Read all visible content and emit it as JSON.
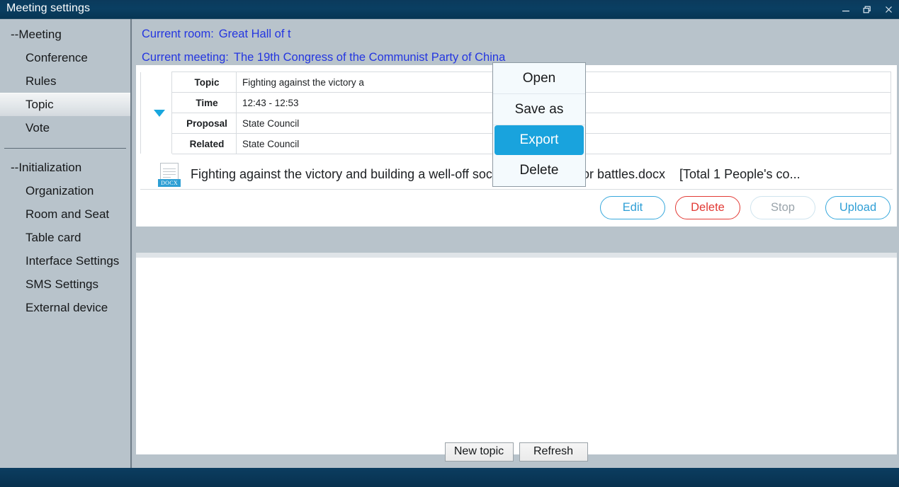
{
  "window": {
    "title": "Meeting settings",
    "controls": [
      {
        "name": "minimize",
        "glyph": "minimize-icon"
      },
      {
        "name": "restore",
        "glyph": "restore-icon"
      },
      {
        "name": "close",
        "glyph": "close-icon"
      }
    ]
  },
  "sidebar": {
    "groups": [
      {
        "head": "--Meeting",
        "items": [
          {
            "label": "Conference",
            "selected": false
          },
          {
            "label": "Rules",
            "selected": false
          },
          {
            "label": "Topic",
            "selected": true
          },
          {
            "label": "Vote",
            "selected": false
          }
        ]
      },
      {
        "head": "--Initialization",
        "items": [
          {
            "label": "Organization",
            "selected": false
          },
          {
            "label": "Room and Seat",
            "selected": false
          },
          {
            "label": "Table card",
            "selected": false
          },
          {
            "label": "Interface Settings",
            "selected": false
          },
          {
            "label": "SMS Settings",
            "selected": false
          },
          {
            "label": "External device",
            "selected": false
          }
        ]
      }
    ]
  },
  "header": {
    "room_label": "Current room:",
    "room_value": "Great Hall of t",
    "meeting_label": "Current meeting:",
    "meeting_value": "The 19th Congress of the Communist Party of China",
    "text_color": "#2436e0"
  },
  "topic_table": {
    "expand_icon": "chevron-down-icon",
    "rows": [
      {
        "label": "Topic",
        "value": "Fighting against the victory a"
      },
      {
        "label": "Time",
        "value": "12:43 - 12:53"
      },
      {
        "label": "Proposal",
        "value": "State Council"
      },
      {
        "label": "Related",
        "value": "State Council"
      }
    ]
  },
  "attachment": {
    "icon": "docx-file-icon",
    "icon_badge": "DOCX",
    "file_name": "Fighting against the victory and building a well-off society in three major battles.docx",
    "meta": "[Total 1 People's co..."
  },
  "actions": [
    {
      "label": "Edit",
      "style": "blue",
      "enabled": true
    },
    {
      "label": "Delete",
      "style": "red",
      "enabled": true
    },
    {
      "label": "Stop",
      "style": "muted",
      "enabled": false
    },
    {
      "label": "Upload",
      "style": "blue",
      "enabled": true
    }
  ],
  "footer": {
    "buttons": [
      {
        "label": "New topic"
      },
      {
        "label": "Refresh"
      }
    ]
  },
  "context_menu": {
    "items": [
      {
        "label": "Open",
        "highlighted": false
      },
      {
        "label": "Save as",
        "highlighted": false
      },
      {
        "label": "Export",
        "highlighted": true
      },
      {
        "label": "Delete",
        "highlighted": false
      }
    ],
    "highlight_color": "#19a3dd"
  },
  "colors": {
    "titlebar": "#0a3a5c",
    "sidebar": "#b8c3cb",
    "accent_blue": "#2f9fd6",
    "danger_red": "#e23a35",
    "link_blue": "#2436e0"
  }
}
